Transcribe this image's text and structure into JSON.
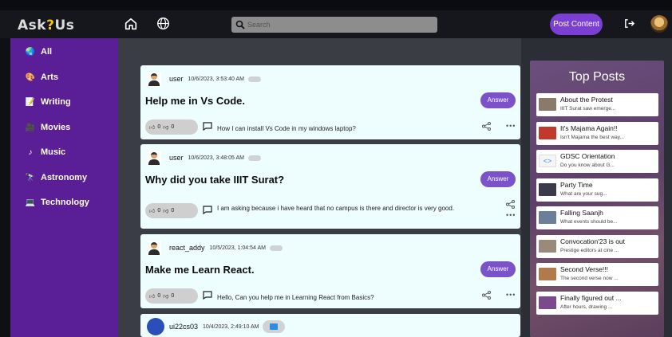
{
  "header": {
    "logo_part1": "Ask",
    "logo_q": "?",
    "logo_part2": "Us",
    "home_icon": "home-icon",
    "globe_icon": "globe-icon",
    "search_placeholder": "Search",
    "post_content_label": "Post Content",
    "logout_icon": "logout-icon"
  },
  "sidebar": {
    "items": [
      {
        "label": "All",
        "icon": "globe-icon"
      },
      {
        "label": "Arts",
        "icon": "palette-icon"
      },
      {
        "label": "Writing",
        "icon": "memo-icon"
      },
      {
        "label": "Movies",
        "icon": "film-icon"
      },
      {
        "label": "Music",
        "icon": "music-note-icon"
      },
      {
        "label": "Astronomy",
        "icon": "telescope-icon"
      },
      {
        "label": "Technology",
        "icon": "computer-icon"
      }
    ]
  },
  "feed": {
    "answer_label": "Answer",
    "posts": [
      {
        "user": "user",
        "time": "10/6/2023, 3:53:40 AM",
        "title": "Help me in Vs Code.",
        "upvotes": "0",
        "downvotes": "0",
        "body": "How I can install Vs Code in my windows laptop?"
      },
      {
        "user": "user",
        "time": "10/6/2023, 3:48:05 AM",
        "title": "Why did you take IIIT Surat?",
        "upvotes": "0",
        "downvotes": "0",
        "body": "I am asking because i have heard that no campus is there and director is very good."
      },
      {
        "user": "react_addy",
        "time": "10/5/2023, 1:04:54 AM",
        "title": "Make me Learn React.",
        "upvotes": "0",
        "downvotes": "0",
        "body": "Hello, Can you help me in Learning React from Basics?"
      },
      {
        "user": "ui22cs03",
        "time": "10/4/2023, 2:49:10 AM",
        "title": "",
        "upvotes": "",
        "downvotes": "",
        "body": ""
      }
    ]
  },
  "top_posts": {
    "title": "Top Posts",
    "items": [
      {
        "title": "About the Protest",
        "sub": "IIIT Surat saw emerge...",
        "color": "#8a7a6a"
      },
      {
        "title": "It's Majama Again!!",
        "sub": "Isn't Majama the best way...",
        "color": "#c0392b"
      },
      {
        "title": "GDSC Orientation",
        "sub": "Do you know about G...",
        "color": "#f5f5f5"
      },
      {
        "title": "Party Time",
        "sub": "What are your sug...",
        "color": "#3a3a4a"
      },
      {
        "title": "Falling Saanjh",
        "sub": "What events should be...",
        "color": "#6a7f9a"
      },
      {
        "title": "Convocation'23 is out",
        "sub": "Prestige editors at cine ...",
        "color": "#9a8a7a"
      },
      {
        "title": "Second Verse!!!",
        "sub": "The second verse now ...",
        "color": "#b07a4a"
      },
      {
        "title": "Finally figured out ...",
        "sub": "After hours, drawing ...",
        "color": "#7a4a8a"
      }
    ]
  }
}
